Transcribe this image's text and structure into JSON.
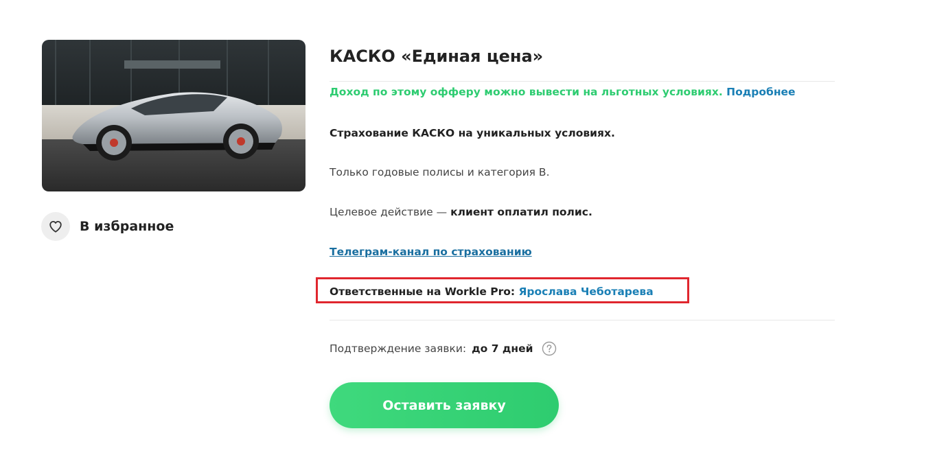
{
  "offer": {
    "title": "КАСКО «Единая цена»",
    "benefit_text": "Доход по этому офферу можно вывести на льготных условиях.",
    "benefit_link": "Подробнее",
    "headline": "Страхование КАСКО на уникальных условиях.",
    "policies": "Только годовые полисы и категория В.",
    "target_prefix": "Целевое действие —",
    "target_action": "клиент оплатил полис.",
    "telegram_link": "Телеграм-канал по страхованию",
    "responsible_label": "Ответственные на Workle Pro:",
    "responsible_name": "Ярослава Чеботарева",
    "confirmation_label": "Подтверждение заявки:",
    "confirmation_value": "до 7 дней",
    "apply_button": "Оставить заявку"
  },
  "favorites": {
    "label": "В избранное",
    "icon": "heart-outline-icon"
  },
  "image": {
    "subject": "silver sports car"
  },
  "colors": {
    "accent_green": "#2ecc71",
    "link_blue": "#1a7fb5",
    "highlight_red": "#e0262e"
  }
}
